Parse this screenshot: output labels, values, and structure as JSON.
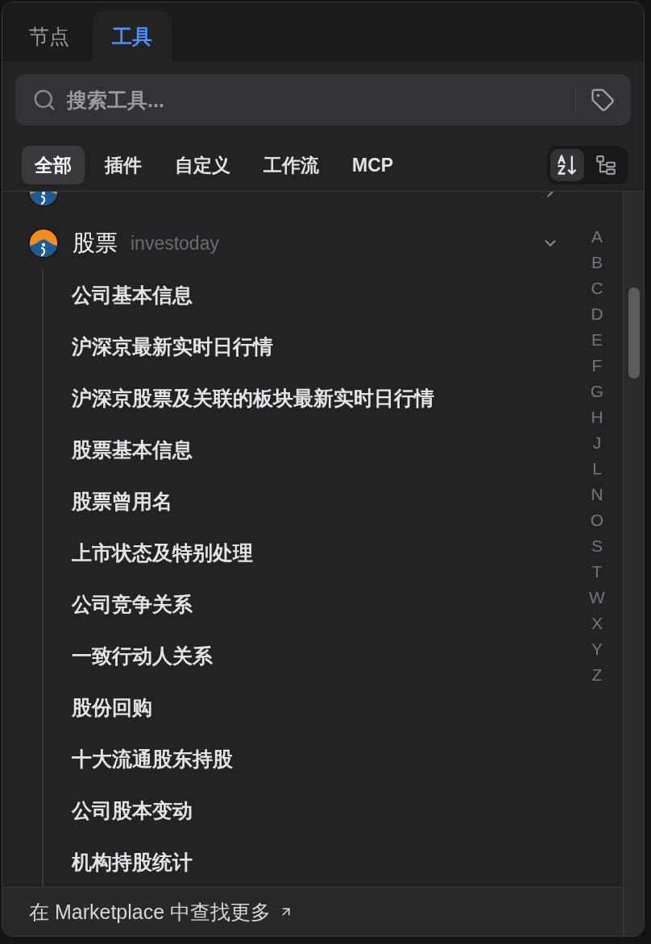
{
  "tabs": [
    {
      "label": "节点",
      "selected": false
    },
    {
      "label": "工具",
      "selected": true
    }
  ],
  "search": {
    "placeholder": "搜索工具..."
  },
  "filters": [
    {
      "label": "全部",
      "selected": true
    },
    {
      "label": "插件",
      "selected": false
    },
    {
      "label": "自定义",
      "selected": false
    },
    {
      "label": "工作流",
      "selected": false
    },
    {
      "label": "MCP",
      "selected": false
    }
  ],
  "view_modes": [
    {
      "kind": "alphabetical",
      "selected": true
    },
    {
      "kind": "tree",
      "selected": false
    }
  ],
  "providers": [
    {
      "expanded": false
    },
    {
      "name": "股票",
      "source": "investoday",
      "expanded": true,
      "tools": [
        "公司基本信息",
        "沪深京最新实时日行情",
        "沪深京股票及关联的板块最新实时日行情",
        "股票基本信息",
        "股票曾用名",
        "上市状态及特别处理",
        "公司竞争关系",
        "一致行动人关系",
        "股份回购",
        "十大流通股东持股",
        "公司股本变动",
        "机构持股统计"
      ]
    }
  ],
  "alphabet_index": [
    "A",
    "B",
    "C",
    "D",
    "E",
    "F",
    "G",
    "H",
    "J",
    "L",
    "N",
    "O",
    "S",
    "T",
    "W",
    "X",
    "Y",
    "Z"
  ],
  "footer": {
    "link": "在 Marketplace 中查找更多"
  }
}
